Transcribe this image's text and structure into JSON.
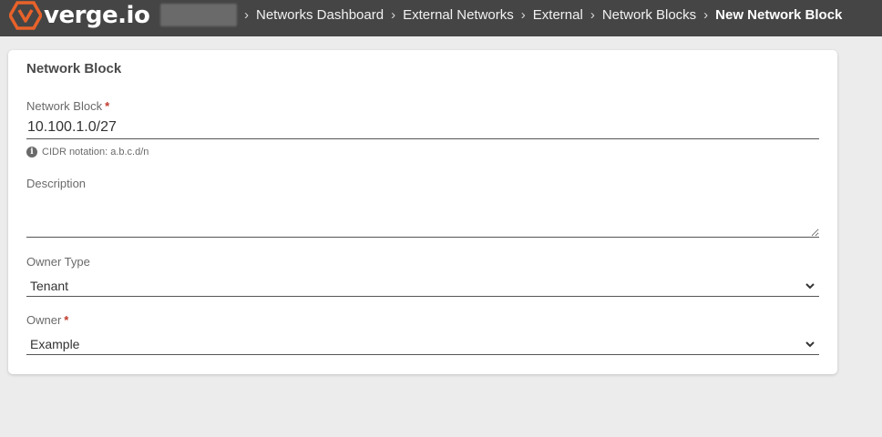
{
  "header": {
    "logo_text": "verge.io",
    "breadcrumbs": [
      {
        "label": "Networks Dashboard"
      },
      {
        "label": "External Networks"
      },
      {
        "label": "External"
      },
      {
        "label": "Network Blocks"
      },
      {
        "label": "New Network Block"
      }
    ],
    "separator": "›",
    "brand_color": "#e8622a"
  },
  "form": {
    "title": "Network Block",
    "network_block": {
      "label": "Network Block",
      "required_mark": "*",
      "value": "10.100.1.0/27",
      "hint": "CIDR notation: a.b.c.d/n"
    },
    "description": {
      "label": "Description",
      "value": ""
    },
    "owner_type": {
      "label": "Owner Type",
      "value": "Tenant"
    },
    "owner": {
      "label": "Owner",
      "required_mark": "*",
      "value": "Example"
    }
  }
}
